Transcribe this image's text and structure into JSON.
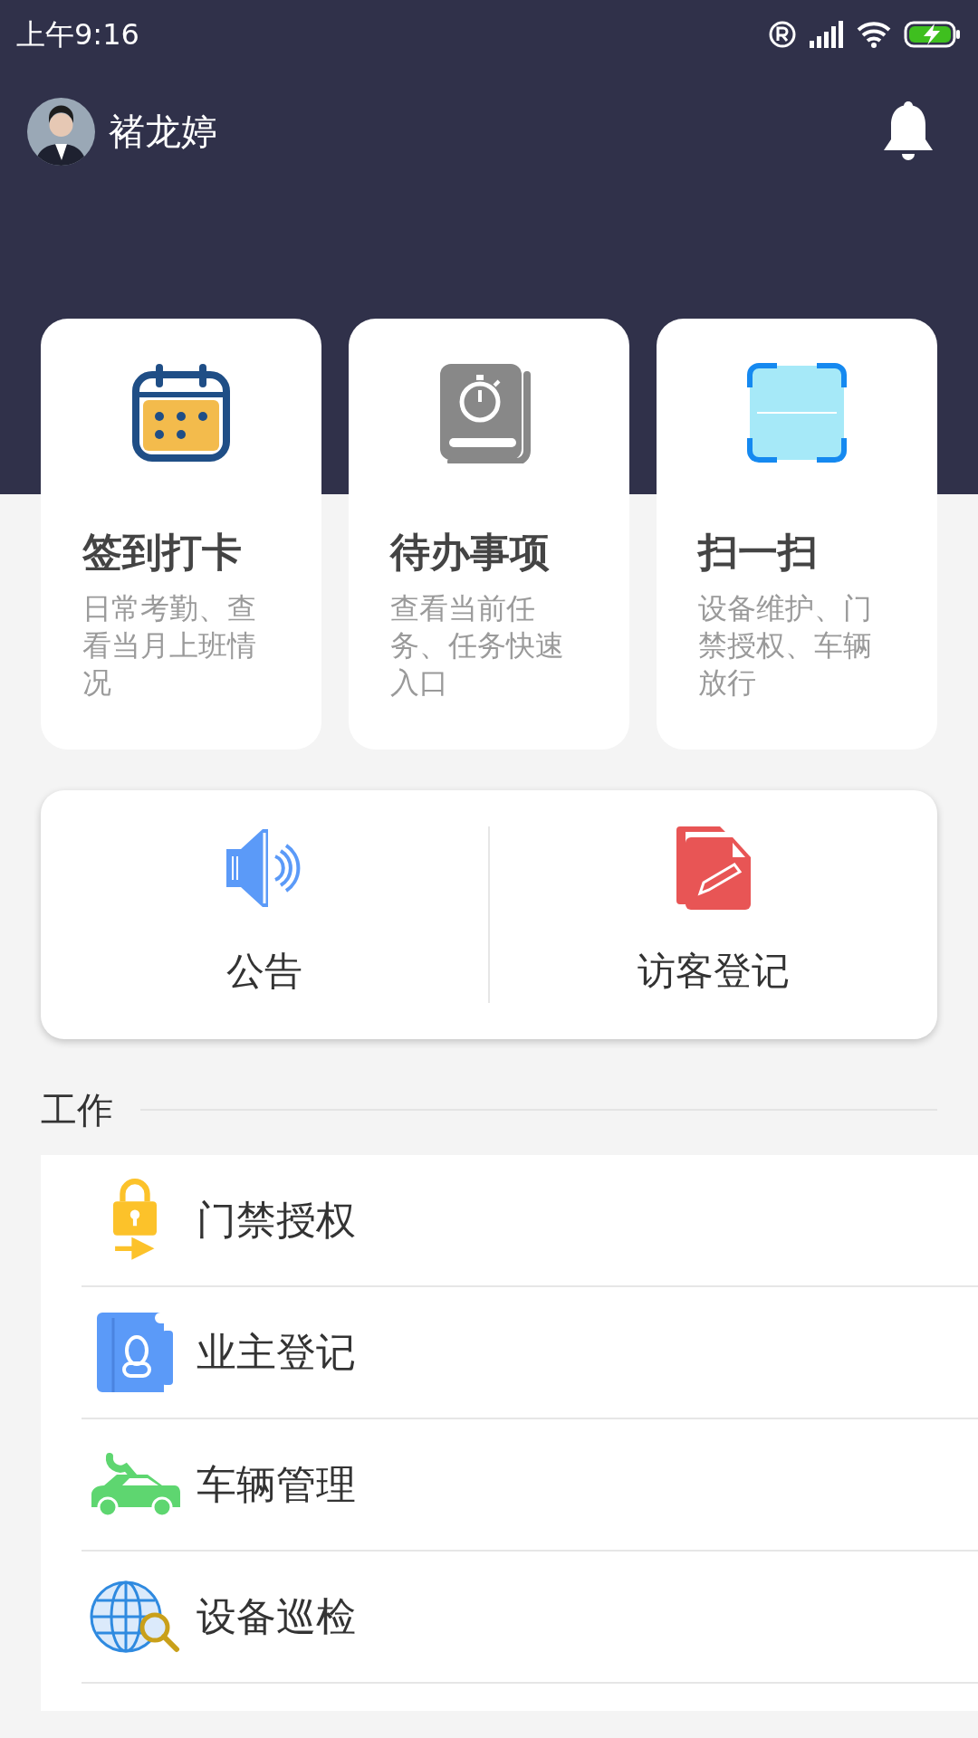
{
  "status_bar": {
    "time": "上午9:16"
  },
  "header": {
    "user_name": "褚龙婷"
  },
  "cards": [
    {
      "kind": "calendar",
      "title": "签到打卡",
      "description": "日常考勤、查看当月上班情况"
    },
    {
      "kind": "todo",
      "title": "待办事项",
      "description": "查看当前任务、任务快速入口"
    },
    {
      "kind": "scan",
      "title": "扫一扫",
      "description": "设备维护、门禁授权、车辆放行"
    }
  ],
  "shortcuts": [
    {
      "kind": "announcement",
      "label": "公告"
    },
    {
      "kind": "visitor",
      "label": "访客登记"
    }
  ],
  "section": {
    "title": "工作"
  },
  "work_items": [
    {
      "kind": "access",
      "label": "门禁授权"
    },
    {
      "kind": "owner",
      "label": "业主登记"
    },
    {
      "kind": "vehicle",
      "label": "车辆管理"
    },
    {
      "kind": "inspection",
      "label": "设备巡检"
    }
  ]
}
